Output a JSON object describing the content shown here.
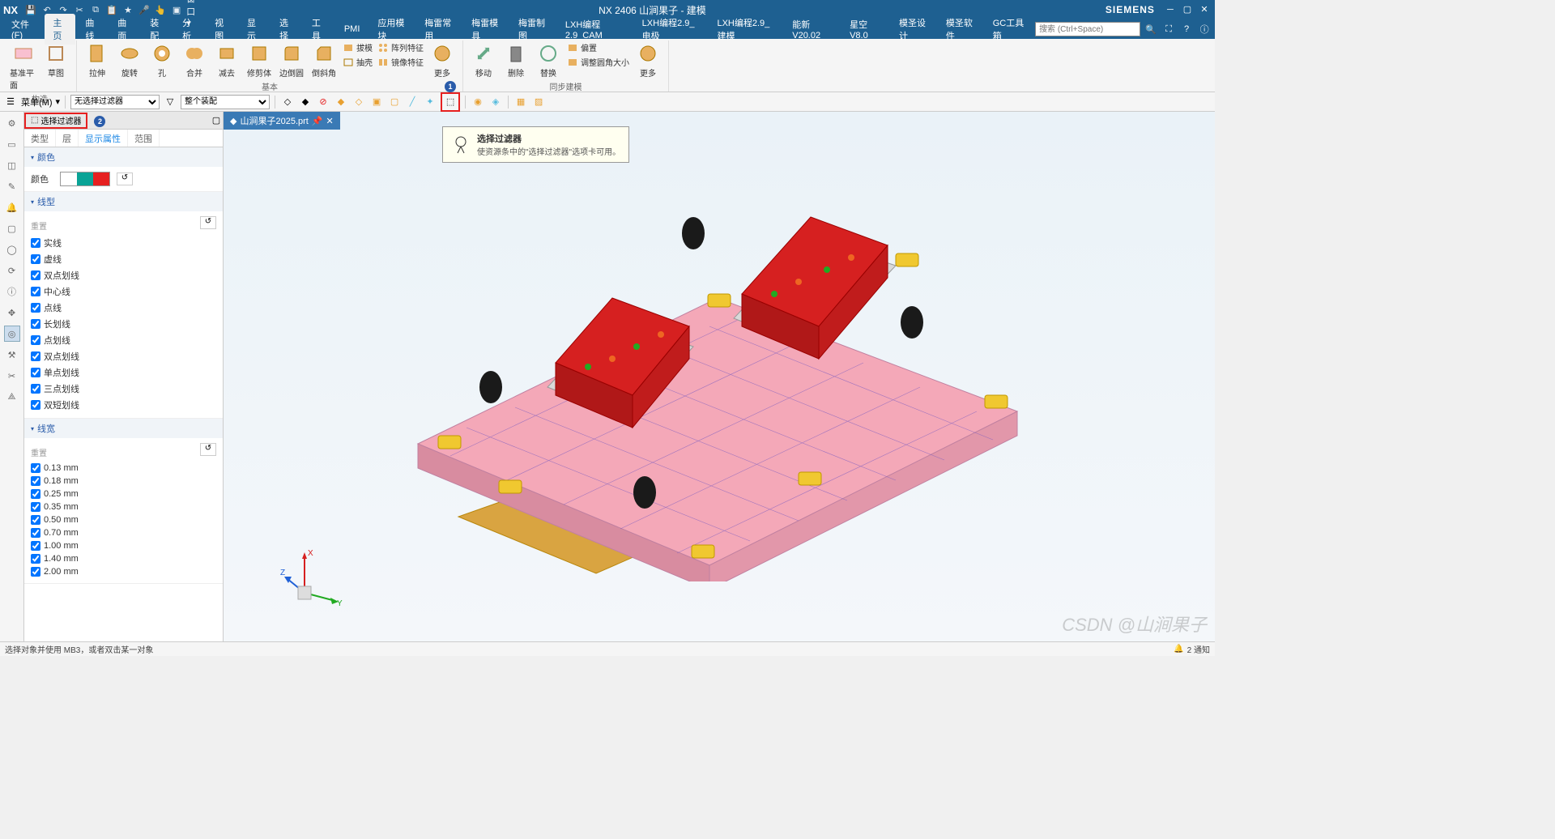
{
  "app": {
    "nx_label": "NX",
    "title": "NX 2406 山涧果子 - 建模",
    "brand": "SIEMENS"
  },
  "menu": {
    "tabs": [
      "文件(F)",
      "主页",
      "曲线",
      "曲面",
      "装配",
      "分析",
      "视图",
      "显示",
      "选择",
      "工具",
      "PMI",
      "应用模块",
      "梅雷常用",
      "梅雷模具",
      "梅雷制图",
      "LXH编程2.9_CAM",
      "LXH编程2.9_电极",
      "LXH编程2.9_建模",
      "能新 V20.02",
      "星空 V8.0",
      "模圣设计",
      "模圣软件",
      "GC工具箱"
    ],
    "search_placeholder": "搜索 (Ctrl+Space)"
  },
  "ribbon": {
    "g1": {
      "label": "构造",
      "datum": "基准平面",
      "sketch": "草图"
    },
    "g2": {
      "label": "基本",
      "extrude": "拉伸",
      "revolve": "旋转",
      "hole": "孔",
      "unite": "合并",
      "subtract": "减去",
      "trim": "修剪体",
      "edgeblend": "边倒圆",
      "chamfer": "倒斜角",
      "draft": "拔模",
      "shell": "抽壳",
      "pattern": "阵列特征",
      "mirror": "镜像特征",
      "more": "更多"
    },
    "g3": {
      "label": "同步建模",
      "move": "移动",
      "delete": "删除",
      "replace": "替换",
      "offset": "偏置",
      "resize": "调整圆角大小",
      "more": "更多"
    }
  },
  "selbar": {
    "menu_label": "菜单(M)",
    "filter1": "无选择过滤器",
    "filter2": "整个装配"
  },
  "panel": {
    "header": "选择过滤器",
    "tabs": [
      "类型",
      "层",
      "显示属性",
      "范围"
    ],
    "section_color": "颜色",
    "color_label": "颜色",
    "section_linestyle": "线型",
    "reset_label": "重置",
    "linestyles": [
      "实线",
      "虚线",
      "双点划线",
      "中心线",
      "点线",
      "长划线",
      "点划线",
      "双点划线",
      "单点划线",
      "三点划线",
      "双短划线"
    ],
    "section_linewidth": "线宽",
    "linewidths": [
      "0.13 mm",
      "0.18 mm",
      "0.25 mm",
      "0.35 mm",
      "0.50 mm",
      "0.70 mm",
      "1.00 mm",
      "1.40 mm",
      "2.00 mm"
    ]
  },
  "document": {
    "tab": "山涧果子2025.prt"
  },
  "tooltip": {
    "title": "选择过滤器",
    "body": "使资源条中的\"选择过滤器\"选项卡可用。"
  },
  "callouts": {
    "c1": "1",
    "c2": "2"
  },
  "triad": {
    "x": "X",
    "y": "Y",
    "z": "Z"
  },
  "watermark": "CSDN @山涧果子",
  "status": {
    "left": "选择对象并使用 MB3，或者双击某一对象",
    "notify": "2 通知"
  }
}
